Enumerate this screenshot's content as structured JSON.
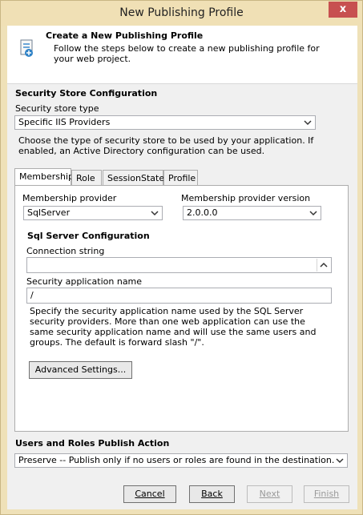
{
  "window": {
    "title": "New Publishing Profile",
    "close_glyph": "x"
  },
  "header": {
    "title": "Create a New Publishing Profile",
    "description": "Follow the steps below to create a new publishing profile for your web project."
  },
  "security": {
    "section_title": "Security Store Configuration",
    "store_type_label": "Security store type",
    "store_type_value": "Specific IIS Providers",
    "description": "Choose the type of security store to be used by your application. If enabled, an Active Directory configuration can be used."
  },
  "tabs": [
    {
      "label": "Membership",
      "active": true
    },
    {
      "label": "Role"
    },
    {
      "label": "SessionState"
    },
    {
      "label": "Profile"
    }
  ],
  "membership": {
    "provider_label": "Membership provider",
    "provider_value": "SqlServer",
    "version_label": "Membership provider version",
    "version_value": "2.0.0.0",
    "sql_section_title": "Sql Server Configuration",
    "connection_label": "Connection string",
    "connection_value": "",
    "app_name_label": "Security application name",
    "app_name_value": "/",
    "app_name_help": "Specify the security application name used by the SQL Server security providers. More than one web application can use the same security application name and will use the same users and groups. The default is forward slash \"/\".",
    "advanced_button": "Advanced Settings..."
  },
  "publish_action": {
    "section_title": "Users and Roles Publish Action",
    "value": "Preserve -- Publish only if no users or roles are found in the destination."
  },
  "footer": {
    "cancel": "Cancel",
    "back": "Back",
    "next": "Next",
    "finish": "Finish"
  }
}
